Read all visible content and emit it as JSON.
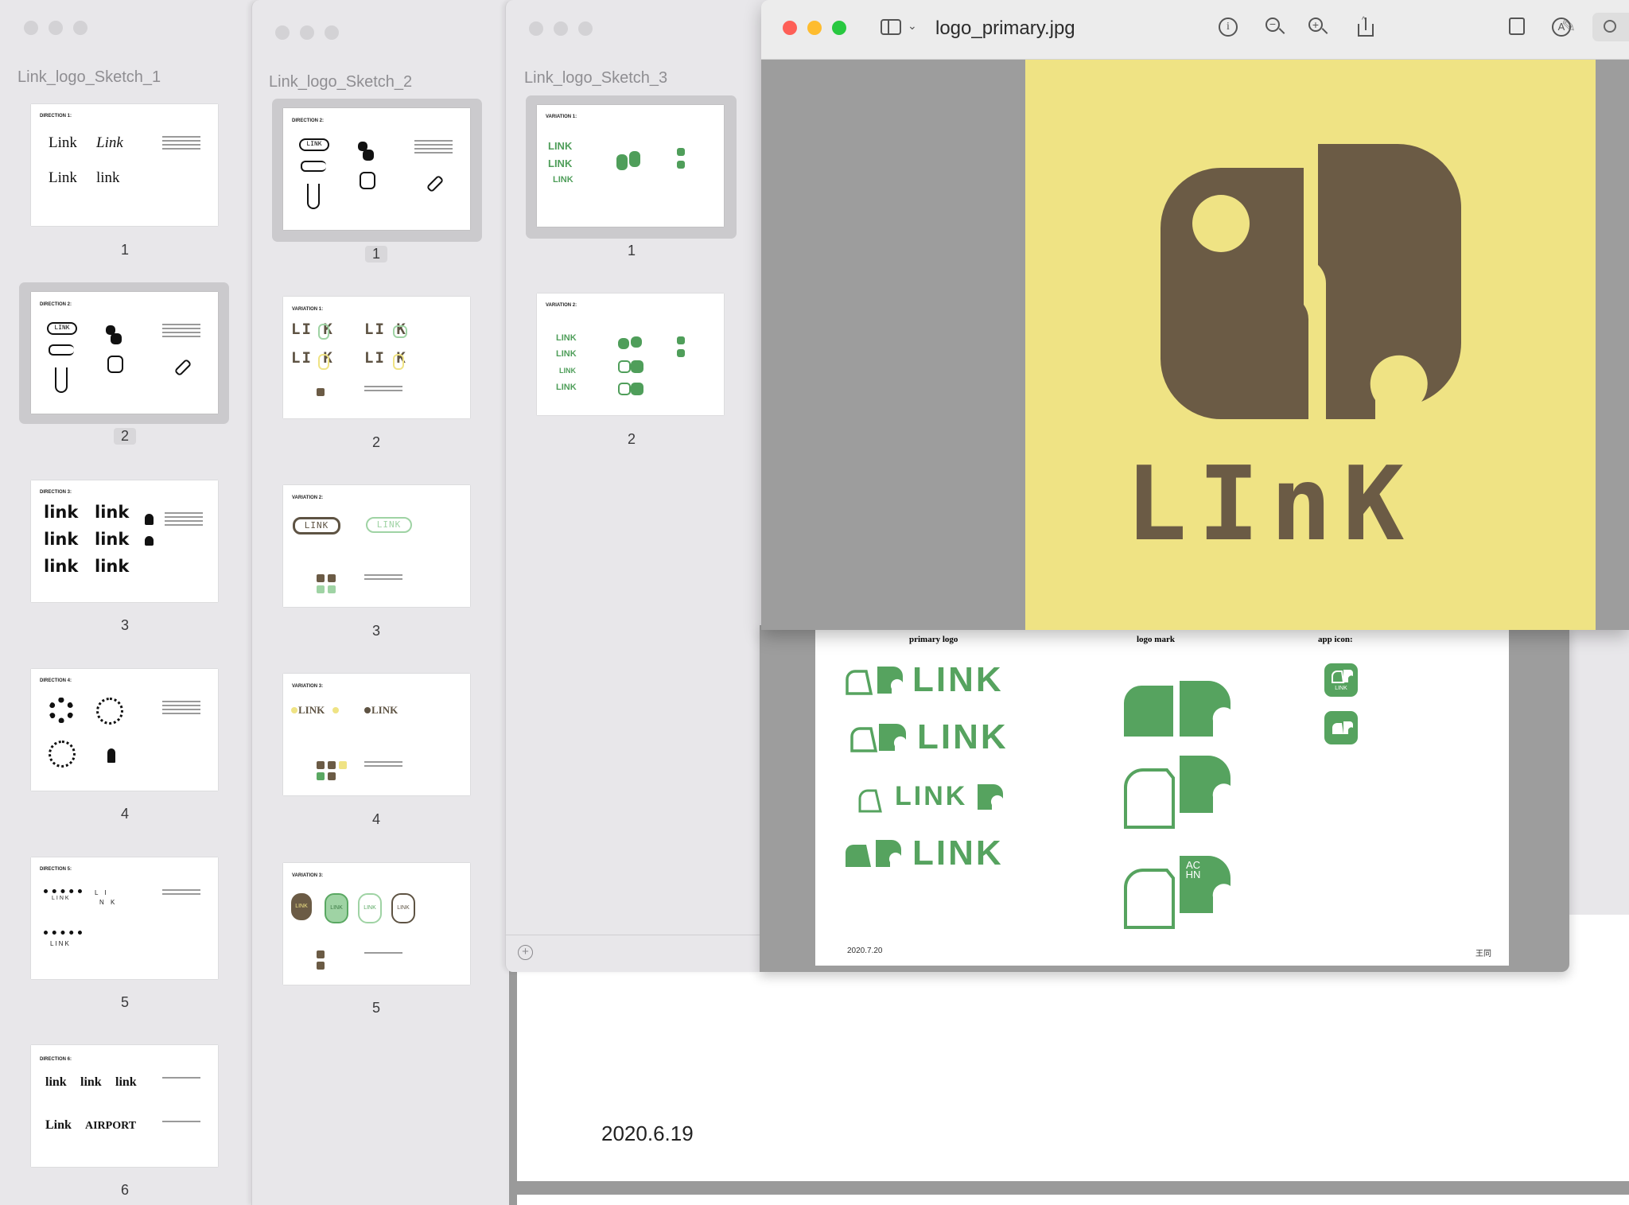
{
  "windows": {
    "sketch1": {
      "title": "Link_logo_Sketch_1",
      "pages": [
        {
          "num": "1",
          "header": "DIRECTION 1:",
          "words": [
            "Link",
            "Link",
            "Link",
            "link"
          ]
        },
        {
          "num": "2",
          "header": "DIRECTION 2:",
          "words": [
            "LINK"
          ]
        },
        {
          "num": "3",
          "header": "DIRECTION 3:",
          "words": [
            "link",
            "link",
            "link",
            "link",
            "link",
            "link"
          ]
        },
        {
          "num": "4",
          "header": "DIRECTION 4:",
          "words": []
        },
        {
          "num": "5",
          "header": "DIRECTION 5:",
          "words": [
            "LINK",
            "L I",
            "N K",
            "LINK"
          ]
        },
        {
          "num": "6",
          "header": "DIRECTION 6:",
          "words": [
            "link",
            "link",
            "link",
            "Link",
            "AIRPORT"
          ]
        }
      ]
    },
    "sketch2": {
      "title": "Link_logo_Sketch_2",
      "pages": [
        {
          "num": "1",
          "header": "DIRECTION 2:",
          "words": [
            "LINK"
          ]
        },
        {
          "num": "2",
          "header": "VARIATION 1:",
          "words": [
            "LI K",
            "LI K",
            "LI K",
            "LI K"
          ]
        },
        {
          "num": "3",
          "header": "VARIATION 2:",
          "words": [
            "LINK",
            "LINK"
          ]
        },
        {
          "num": "4",
          "header": "VARIATION 3:",
          "words": [
            "LINK",
            "LINK"
          ]
        },
        {
          "num": "5",
          "header": "VARIATION 3:",
          "words": [
            "LINK",
            "LINK",
            "LINK",
            "LINK"
          ]
        }
      ]
    },
    "sketch3": {
      "title": "Link_logo_Sketch_3",
      "pages": [
        {
          "num": "1",
          "header": "VARIATION 1:",
          "words": [
            "LINK",
            "LINK",
            "LINK"
          ]
        },
        {
          "num": "2",
          "header": "VARIATION 2:",
          "words": [
            "LINK",
            "LINK",
            "LINK",
            "LINK"
          ]
        }
      ]
    }
  },
  "preview": {
    "filename": "logo_primary.jpg",
    "logo_text": "LInK",
    "toolbar": [
      "sidebar-icon",
      "info-icon",
      "zoom-out-icon",
      "zoom-in-icon",
      "share-icon",
      "markup-icon",
      "rotate-icon",
      "annotate-icon",
      "search-icon"
    ]
  },
  "behind_doc": {
    "col_primary": "primary logo",
    "col_mark": "logo mark",
    "col_app": "app icon:",
    "logos": [
      "LINK",
      "LINK",
      "LINK",
      "LINK"
    ],
    "app_label": "LINK",
    "mark_text": "AC HN",
    "date": "2020.7.20",
    "author": "王同"
  },
  "bottom_doc": {
    "date": "2020.6.19"
  },
  "colors": {
    "green": "#56a35f",
    "brown": "#6b5b45",
    "yellow": "#efe384",
    "mint": "#9fd3a4"
  }
}
